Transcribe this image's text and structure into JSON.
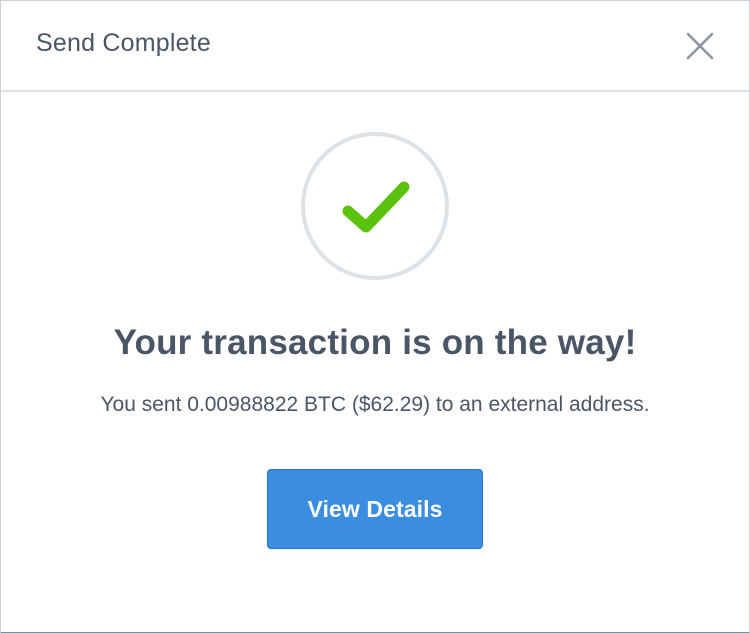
{
  "dialog": {
    "title": "Send Complete",
    "close_icon": "close-icon"
  },
  "status": {
    "icon": "checkmark-icon",
    "ring_color": "#dde2e7",
    "check_color": "#5ac10c",
    "headline": "Your transaction is on the way!",
    "message": "You sent 0.00988822 BTC ($62.29) to an external address."
  },
  "actions": {
    "view_details_label": "View Details",
    "button_color": "#3b8de0"
  }
}
